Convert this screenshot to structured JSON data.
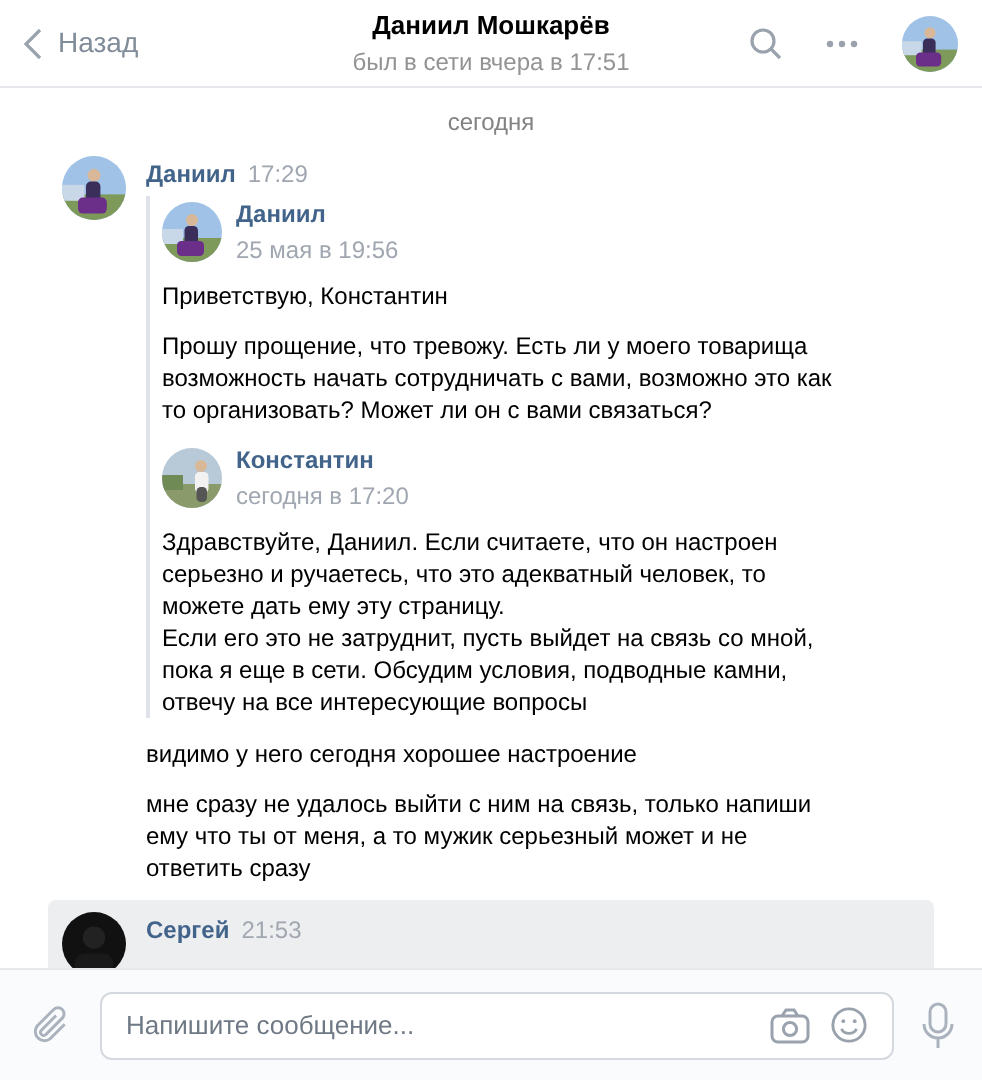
{
  "header": {
    "back": "Назад",
    "title": "Даниил Мошкарёв",
    "status": "был в сети вчера в 17:51"
  },
  "date_divider": "сегодня",
  "messages": [
    {
      "author": "Даниил",
      "time": "17:29",
      "highlighted": false,
      "forwarded": [
        {
          "author": "Даниил",
          "date": "25 мая в 19:56",
          "paragraphs": [
            "Приветствую, Константин",
            "Прошу прощение, что тревожу. Есть ли у моего товарища возможность начать сотрудничать с вами, возможно это как то организовать? Может ли он с вами связаться?"
          ]
        },
        {
          "author": "Константин",
          "date": "сегодня в 17:20",
          "paragraphs": [
            "Здравствуйте, Даниил. Если считаете, что он настроен серьезно и ручаетесь, что это адекватный человек, то можете дать ему эту страницу.\nЕсли его это не затруднит, пусть выйдет на связь со мной, пока я еще в сети. Обсудим условия, подводные камни, отвечу на все интересующие вопросы"
          ]
        }
      ],
      "paragraphs": [
        "видимо у него сегодня хорошее настроение",
        "мне сразу не удалось выйти с ним на связь, только напиши ему что ты от меня, а то мужик серьезный может и не ответить сразу"
      ]
    },
    {
      "author": "Сергей",
      "time": "21:53",
      "highlighted": true
    }
  ],
  "composer": {
    "placeholder": "Напишите сообщение..."
  }
}
